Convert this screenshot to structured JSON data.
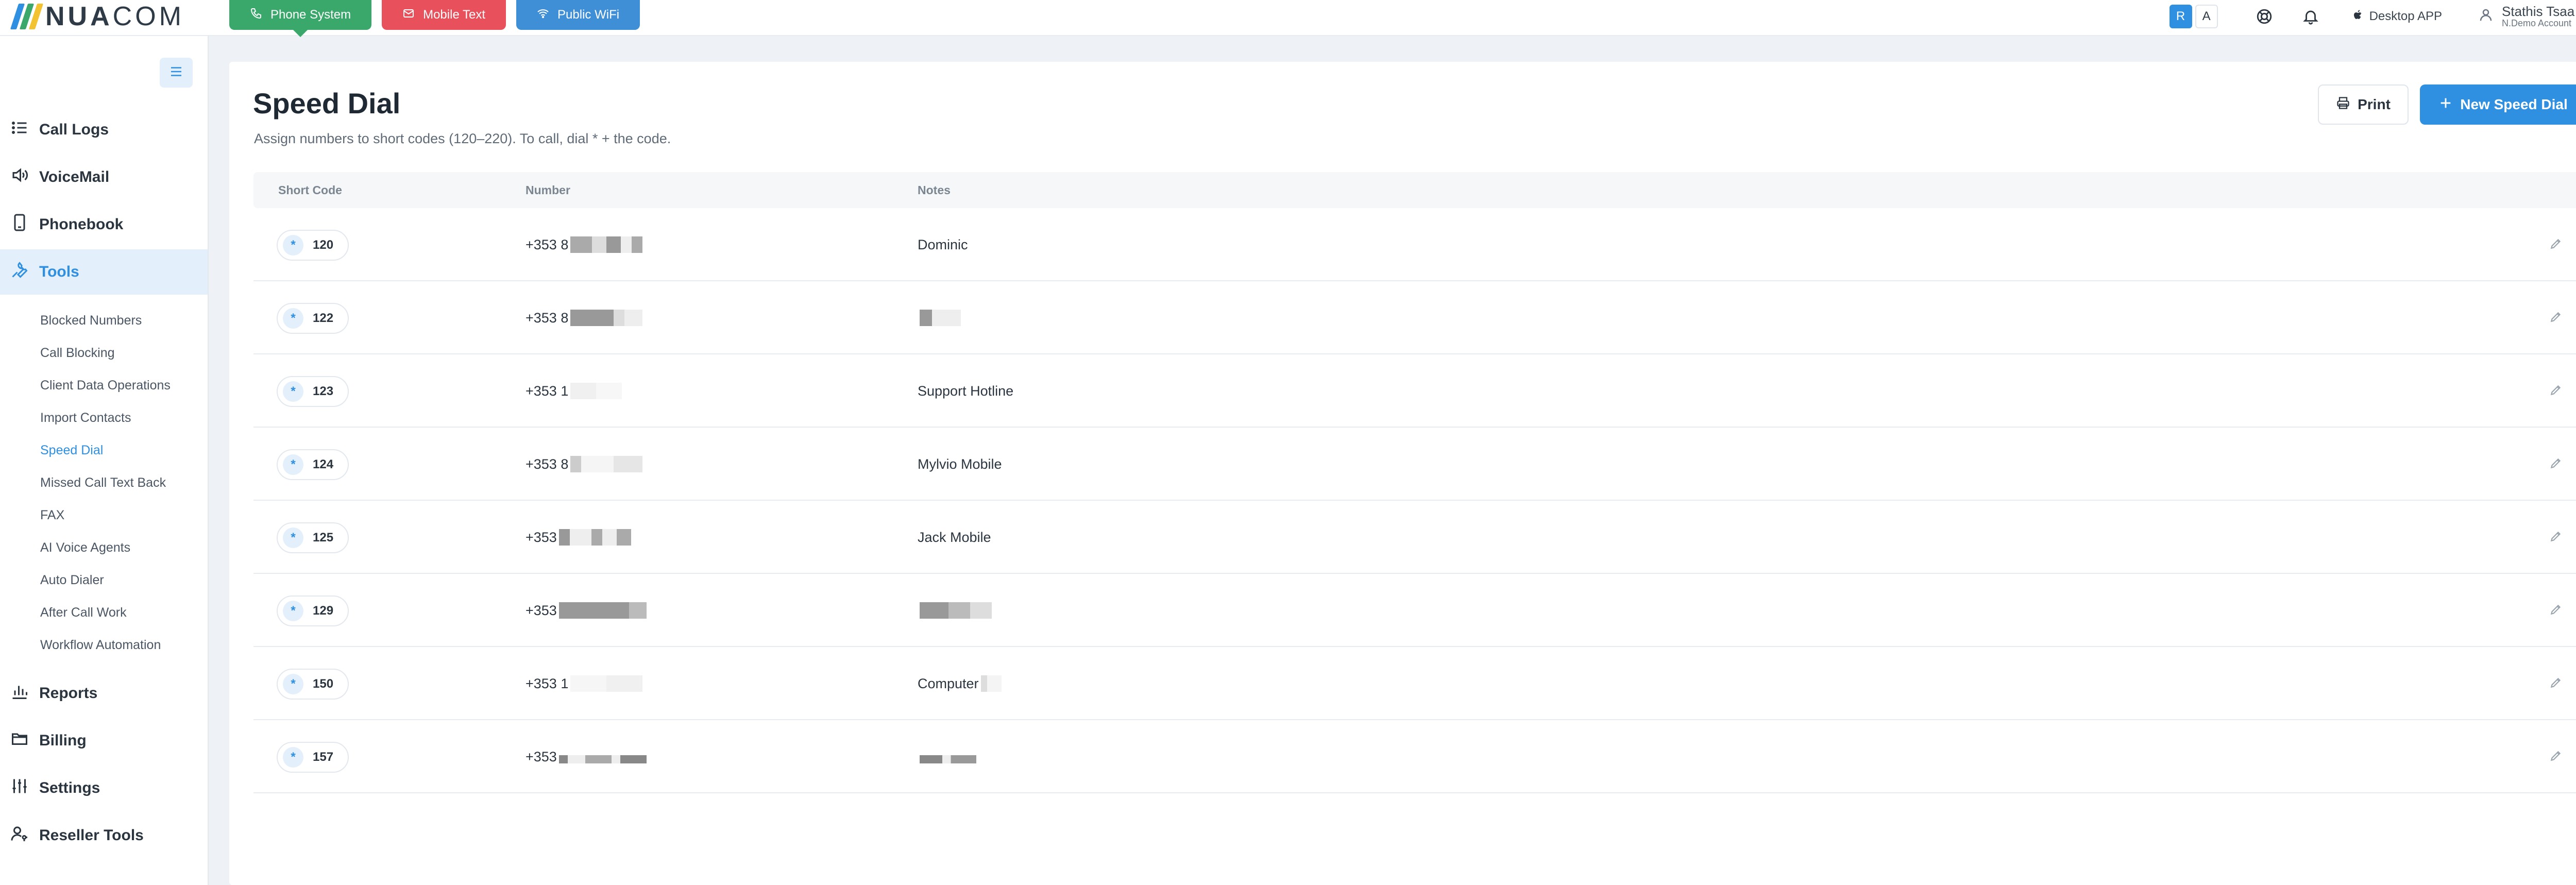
{
  "brand": {
    "logo_text_bold": "NUA",
    "logo_text_light": "COM",
    "logo_colors": [
      "#2f8fe0",
      "#3aa86a",
      "#f2c230"
    ]
  },
  "product_tabs": [
    {
      "label": "Phone System",
      "icon": "phone-icon",
      "color": "#3aa86a",
      "active": true
    },
    {
      "label": "Mobile Text",
      "icon": "mail-icon",
      "color": "#e8505b",
      "active": false
    },
    {
      "label": "Public WiFi",
      "icon": "wifi-icon",
      "color": "#3f8fd6",
      "active": false
    }
  ],
  "header": {
    "languages": [
      "R",
      "A"
    ],
    "active_language": "R",
    "desktop_app_label": "Desktop APP",
    "user_name": "Stathis Tsaa",
    "user_account": "N.Demo Account"
  },
  "sidebar": {
    "items": [
      {
        "label": "Call Logs",
        "icon": "list-icon"
      },
      {
        "label": "VoiceMail",
        "icon": "speaker-icon"
      },
      {
        "label": "Phonebook",
        "icon": "phone-book-icon"
      },
      {
        "label": "Tools",
        "icon": "wrench-icon",
        "active": true
      },
      {
        "label": "Reports",
        "icon": "bar-chart-icon"
      },
      {
        "label": "Billing",
        "icon": "folder-icon"
      },
      {
        "label": "Settings",
        "icon": "sliders-icon"
      },
      {
        "label": "Reseller Tools",
        "icon": "user-key-icon"
      }
    ],
    "tools_subitems": [
      "Blocked Numbers",
      "Call Blocking",
      "Client Data Operations",
      "Import Contacts",
      "Speed Dial",
      "Missed Call Text Back",
      "FAX",
      "AI Voice Agents",
      "Auto Dialer",
      "After Call Work",
      "Workflow Automation"
    ],
    "active_subitem": "Speed Dial"
  },
  "page": {
    "title": "Speed Dial",
    "subtitle": "Assign numbers to short codes (120–220). To call, dial * + the code.",
    "print_label": "Print",
    "new_label": "New Speed Dial"
  },
  "table": {
    "columns": [
      "Short Code",
      "Number",
      "Notes"
    ],
    "rows": [
      {
        "code": "120",
        "number": "+353 8",
        "notes": "Dominic"
      },
      {
        "code": "122",
        "number": "+353 8",
        "notes": ""
      },
      {
        "code": "123",
        "number": "+353 1",
        "notes": "Support Hotline"
      },
      {
        "code": "124",
        "number": "+353 8",
        "notes": "Mylvio Mobile"
      },
      {
        "code": "125",
        "number": "+353",
        "notes": "Jack Mobile"
      },
      {
        "code": "129",
        "number": "+353",
        "notes": ""
      },
      {
        "code": "150",
        "number": "+353 1",
        "notes": "Computer"
      },
      {
        "code": "157",
        "number": "+353",
        "notes": ""
      }
    ]
  },
  "colors": {
    "accent": "#2f8fe0",
    "active_bg": "#e3f0fb",
    "redaction": "#9a9a9a"
  }
}
